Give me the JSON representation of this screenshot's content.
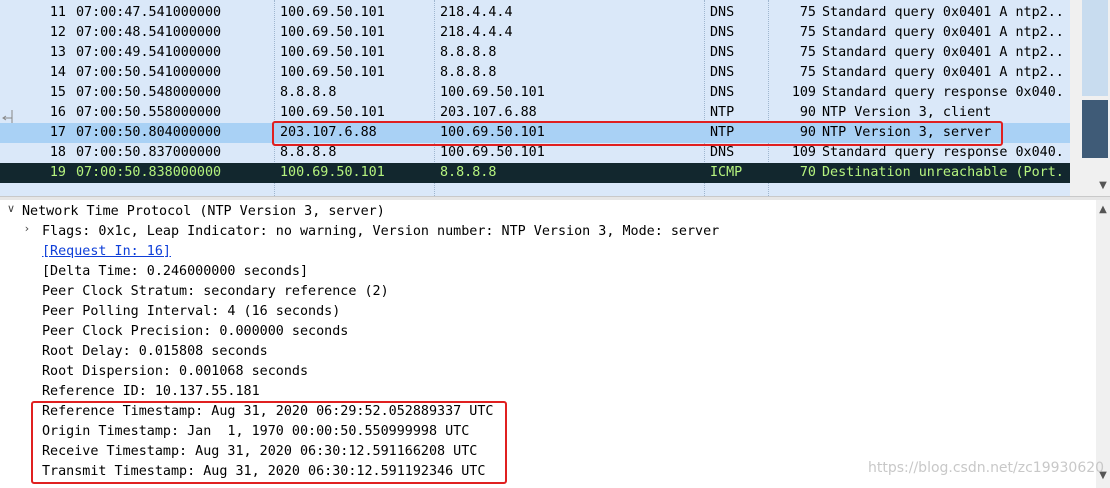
{
  "packets": [
    {
      "no": "11",
      "time": "07:00:47.541000000",
      "src": "100.69.50.101",
      "dst": "218.4.4.4",
      "proto": "DNS",
      "len": "75",
      "info": "Standard query 0x0401 A ntp2..."
    },
    {
      "no": "12",
      "time": "07:00:48.541000000",
      "src": "100.69.50.101",
      "dst": "218.4.4.4",
      "proto": "DNS",
      "len": "75",
      "info": "Standard query 0x0401 A ntp2..."
    },
    {
      "no": "13",
      "time": "07:00:49.541000000",
      "src": "100.69.50.101",
      "dst": "8.8.8.8",
      "proto": "DNS",
      "len": "75",
      "info": "Standard query 0x0401 A ntp2..."
    },
    {
      "no": "14",
      "time": "07:00:50.541000000",
      "src": "100.69.50.101",
      "dst": "8.8.8.8",
      "proto": "DNS",
      "len": "75",
      "info": "Standard query 0x0401 A ntp2..."
    },
    {
      "no": "15",
      "time": "07:00:50.548000000",
      "src": "8.8.8.8",
      "dst": "100.69.50.101",
      "proto": "DNS",
      "len": "109",
      "info": "Standard query response 0x040..."
    },
    {
      "no": "16",
      "time": "07:00:50.558000000",
      "src": "100.69.50.101",
      "dst": "203.107.6.88",
      "proto": "NTP",
      "len": "90",
      "info": "NTP Version 3, client"
    },
    {
      "no": "17",
      "time": "07:00:50.804000000",
      "src": "203.107.6.88",
      "dst": "100.69.50.101",
      "proto": "NTP",
      "len": "90",
      "info": "NTP Version 3, server"
    },
    {
      "no": "18",
      "time": "07:00:50.837000000",
      "src": "8.8.8.8",
      "dst": "100.69.50.101",
      "proto": "DNS",
      "len": "109",
      "info": "Standard query response 0x040..."
    },
    {
      "no": "19",
      "time": "07:00:50.838000000",
      "src": "100.69.50.101",
      "dst": "8.8.8.8",
      "proto": "ICMP",
      "len": "70",
      "info": "Destination unreachable (Port..."
    }
  ],
  "selected_packet": "17",
  "details": {
    "header": "Network Time Protocol (NTP Version 3, server)",
    "flags": "Flags: 0x1c, Leap Indicator: no warning, Version number: NTP Version 3, Mode: server",
    "request_in": "[Request In: 16]",
    "delta_time": "[Delta Time: 0.246000000 seconds]",
    "stratum": "Peer Clock Stratum: secondary reference (2)",
    "polling": "Peer Polling Interval: 4 (16 seconds)",
    "precision": "Peer Clock Precision: 0.000000 seconds",
    "root_delay": "Root Delay: 0.015808 seconds",
    "root_dispersion": "Root Dispersion: 0.001068 seconds",
    "reference_id": "Reference ID: 10.137.55.181",
    "reference_ts": "Reference Timestamp: Aug 31, 2020 06:29:52.052889337 UTC",
    "origin_ts": "Origin Timestamp: Jan  1, 1970 00:00:50.550999998 UTC",
    "receive_ts": "Receive Timestamp: Aug 31, 2020 06:30:12.591166208 UTC",
    "transmit_ts": "Transmit Timestamp: Aug 31, 2020 06:30:12.591192346 UTC"
  },
  "watermark": "https://blog.csdn.net/zc19930620",
  "colors": {
    "list_bg": "#dae8f9",
    "selected_bg": "#a9d1f5",
    "dark_bg": "#12272e",
    "dark_fg": "#b5f37f",
    "highlight": "#e02020",
    "link": "#0f3fd8"
  }
}
